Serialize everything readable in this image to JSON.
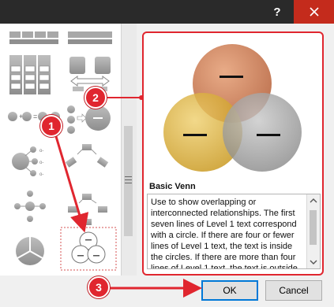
{
  "titlebar": {
    "help_label": "?",
    "close_label": "✕"
  },
  "preview": {
    "title": "Basic Venn",
    "description": "Use to show overlapping or interconnected relationships. The first seven lines of Level 1 text correspond with a circle. If there are four or fewer lines of Level 1 text, the text is inside the circles. If there are more than four lines of Level 1 text, the text is outside"
  },
  "buttons": {
    "ok_label": "OK",
    "cancel_label": "Cancel"
  },
  "callouts": {
    "one": "1",
    "two": "2",
    "three": "3"
  },
  "colors": {
    "accent_red": "#e0262f",
    "venn_top": "#c97a50",
    "venn_left": "#d9a82a",
    "venn_right": "#9a9a9a",
    "focus_blue": "#0078d7"
  },
  "icons": {
    "close": "close-icon",
    "help": "help-icon",
    "scroll_up": "chevron-up-icon",
    "scroll_down": "chevron-down-icon"
  }
}
